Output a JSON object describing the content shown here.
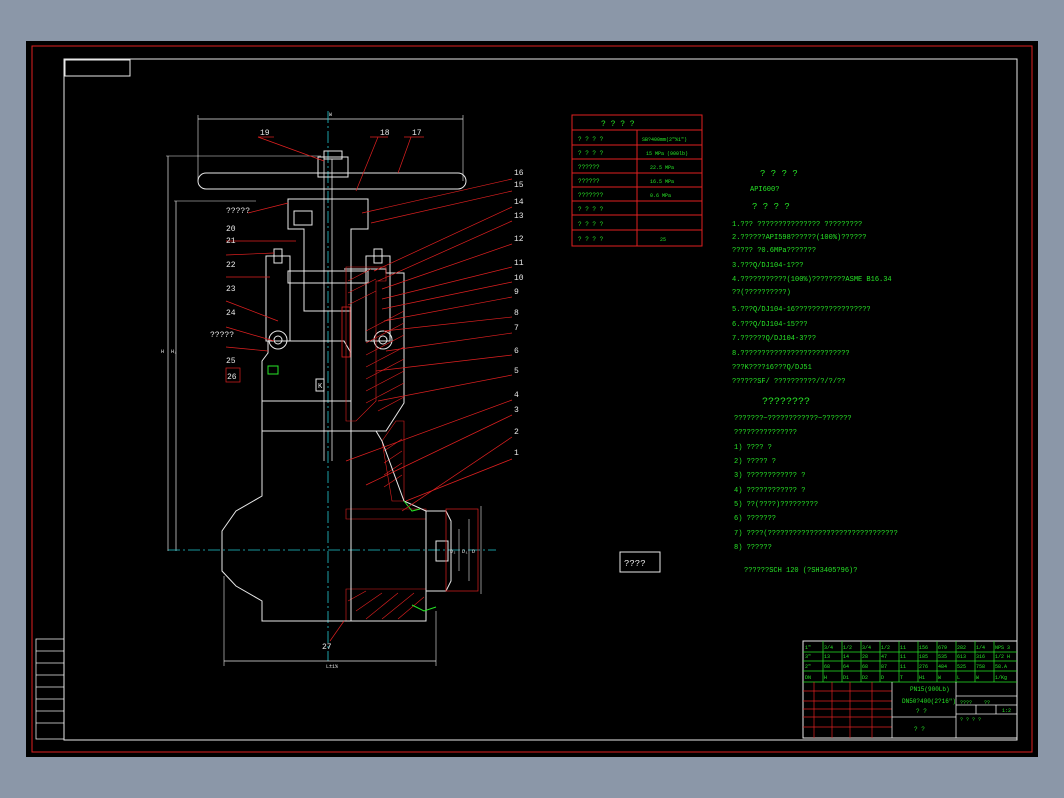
{
  "drawing": {
    "part_numbers_right": [
      "16",
      "15",
      "14",
      "13",
      "12",
      "11",
      "10",
      "9",
      "8",
      "7",
      "6",
      "5",
      "4",
      "3",
      "2",
      "1"
    ],
    "part_numbers_left": [
      "19",
      "18",
      "17",
      "20",
      "21",
      "22",
      "23",
      "24",
      "25",
      "26"
    ],
    "bottom_label": "27",
    "unknown_callouts": [
      "?????",
      "?????"
    ],
    "dims": {
      "top": "W",
      "bottom": "L±1%",
      "v1": "H",
      "v2": "H₁",
      "r1": "D",
      "r2": "D₁",
      "r3": "D₂"
    },
    "center_mark": "K"
  },
  "spec_table": {
    "title": "?  ?  ?  ?",
    "rows": [
      [
        "? ? ? ?",
        "SB?400mm(2\"%1\")"
      ],
      [
        "? ? ? ?",
        "15 MPa (900lb)"
      ],
      [
        "??????",
        "22.5 MPa"
      ],
      [
        "??????",
        "16.5 MPa"
      ],
      [
        "???????",
        "0.6 MPa"
      ],
      [
        "? ? ? ?",
        ""
      ],
      [
        "? ? ? ?",
        ""
      ],
      [
        "? ? ? ?",
        "25"
      ]
    ]
  },
  "notes": {
    "title1": "?  ?  ?  ?",
    "sub1": "API600?",
    "title2": "?  ?  ?  ?",
    "lines": [
      "1.???  ???????????????                ?????????",
      "2.??????API598??????(100%)??????",
      "   ?????    ?0.6MPa???????",
      "3.???Q/DJ104-1???",
      "4.???????????(100%)????????ASME B16.34",
      "   ??(??????????)",
      "5.???Q/DJ104-16??????????????????",
      "6.???Q/DJ104-15???",
      "7.??????Q/DJ104-3???",
      "8.??????????????????????????",
      "   ???K????16???Q/DJ51",
      "   ??????SF/        ??????????/?/?/??"
    ],
    "subtitle": "????????",
    "list_intro": [
      "???????~????????????~???????",
      "???????????????"
    ],
    "list": [
      "1)  ????    ?",
      "2)  ?????    ?",
      "3)  ????????????          ?",
      "4)  ????????????          ?",
      "5)  ??(????)?????????",
      "6)  ???????",
      "7)  ????(???????????????????????????????",
      "8)  ??????"
    ],
    "last": "??????SCH 120  (?SH3405?96)?",
    "boxed": "????"
  },
  "title_block": {
    "grid": [
      [
        "1\"",
        "3/4",
        "1/2",
        "3/4",
        "1/2",
        "11",
        "156",
        "679",
        "282",
        "1/4",
        "NPS 3"
      ],
      [
        "3\"",
        "13",
        "14",
        "28",
        "47",
        "11",
        "185",
        "535",
        "613",
        "316",
        "1/2 H"
      ],
      [
        "2\"",
        "68",
        "64",
        "68",
        "87",
        "11",
        "276",
        "484",
        "525",
        "758",
        "58.A"
      ],
      [
        "DN",
        "H",
        "D1",
        "D2",
        "D",
        "T",
        "H1",
        "W",
        "L",
        "W",
        "1/Kg"
      ]
    ],
    "name1": "PN15(900Lb)",
    "name2": "DN50?400(2?16\")",
    "name3": "?  ?",
    "drawing_no": "?  ?",
    "small": [
      "????",
      "??",
      "??",
      "1:2",
      "?  ?  ?  ?",
      "?"
    ]
  },
  "colors": {
    "border": "#e02020",
    "line": "#e8e8e8",
    "text": "#27e627",
    "center": "#22c8d0"
  }
}
